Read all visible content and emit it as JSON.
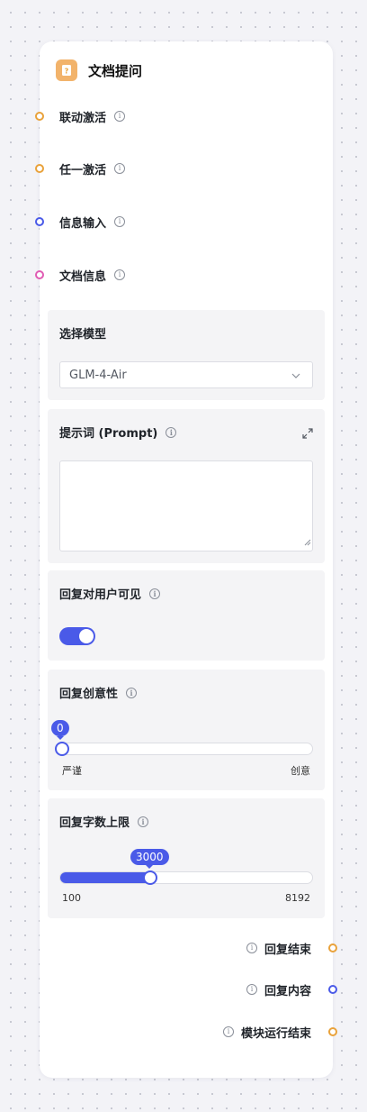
{
  "node": {
    "title": "文档提问",
    "icon": "question-doc-icon",
    "accent": "#f2b36b"
  },
  "inputs": [
    {
      "label": "联动激活",
      "port_color": "#e9a23b"
    },
    {
      "label": "任一激活",
      "port_color": "#e9a23b"
    },
    {
      "label": "信息输入",
      "port_color": "#4a5ae8"
    },
    {
      "label": "文档信息",
      "port_color": "#e05bb3"
    }
  ],
  "model": {
    "title": "选择模型",
    "value": "GLM-4-Air"
  },
  "prompt": {
    "title": "提示词 (Prompt)",
    "value": ""
  },
  "visible": {
    "title": "回复对用户可见",
    "enabled": true
  },
  "creativity": {
    "title": "回复创意性",
    "value": "0",
    "value_fraction": 0,
    "min_label": "严谨",
    "max_label": "创意"
  },
  "max_chars": {
    "title": "回复字数上限",
    "value": "3000",
    "min": "100",
    "max": "8192",
    "value_fraction": 0.36
  },
  "outputs": [
    {
      "label": "回复结束",
      "port_color": "#e9a23b"
    },
    {
      "label": "回复内容",
      "port_color": "#4a5ae8"
    },
    {
      "label": "模块运行结束",
      "port_color": "#e9a23b"
    }
  ],
  "colors": {
    "primary": "#4a5ae8",
    "canvas": "#f3f3f7"
  }
}
